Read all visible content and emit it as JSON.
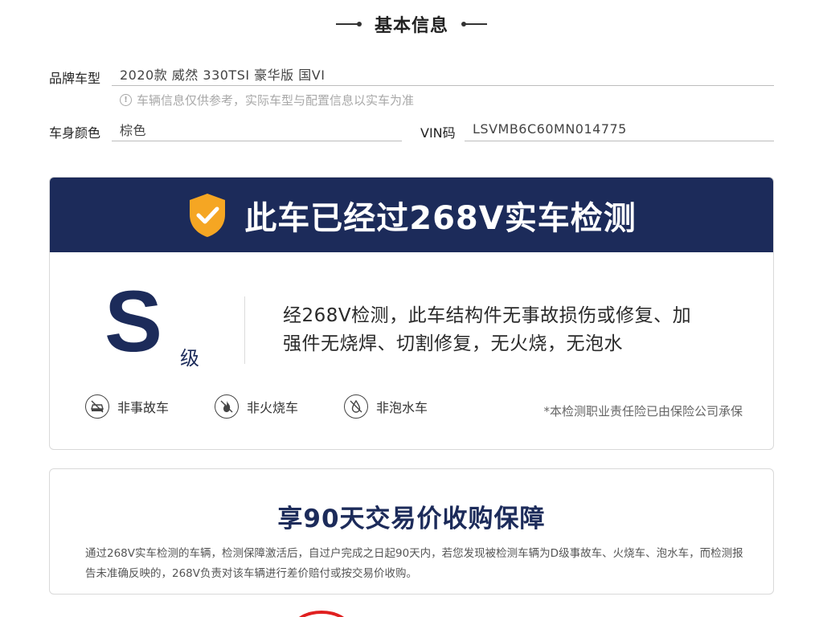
{
  "section": {
    "title": "基本信息"
  },
  "info": {
    "brand_label": "品牌车型",
    "brand_value": "2020款 威然 330TSI 豪华版 国VI",
    "hint": "车辆信息仅供参考，实际车型与配置信息以实车为准",
    "color_label": "车身颜色",
    "color_value": "棕色",
    "vin_label": "VIN码",
    "vin_value": "LSVMB6C60MN014775"
  },
  "inspection": {
    "headline": "此车已经过268V实车检测",
    "grade": "S",
    "grade_suffix": "级",
    "desc_line1": "经268V检测，此车结构件无事故损伤或修复、加",
    "desc_line2": "强件无烧焊、切割修复，无火烧，无泡水",
    "features": [
      {
        "label": "非事故车",
        "icon": "no-accident-icon"
      },
      {
        "label": "非火烧车",
        "icon": "no-fire-icon"
      },
      {
        "label": "非泡水车",
        "icon": "no-flood-icon"
      }
    ],
    "insurance_note": "*本检测职业责任险已由保险公司承保"
  },
  "guarantee": {
    "title": "享90天交易价收购保障",
    "body": "通过268V实车检测的车辆，检测保障激活后，自过户完成之日起90天内，若您发现被检测车辆为D级事故车、火烧车、泡水车，而检测报告未准确反映的，268V负责对该车辆进行差价赔付或按交易价收购。"
  },
  "colors": {
    "navy": "#1c2b5a",
    "shield": "#f5a623",
    "accent_red": "#e02020"
  }
}
